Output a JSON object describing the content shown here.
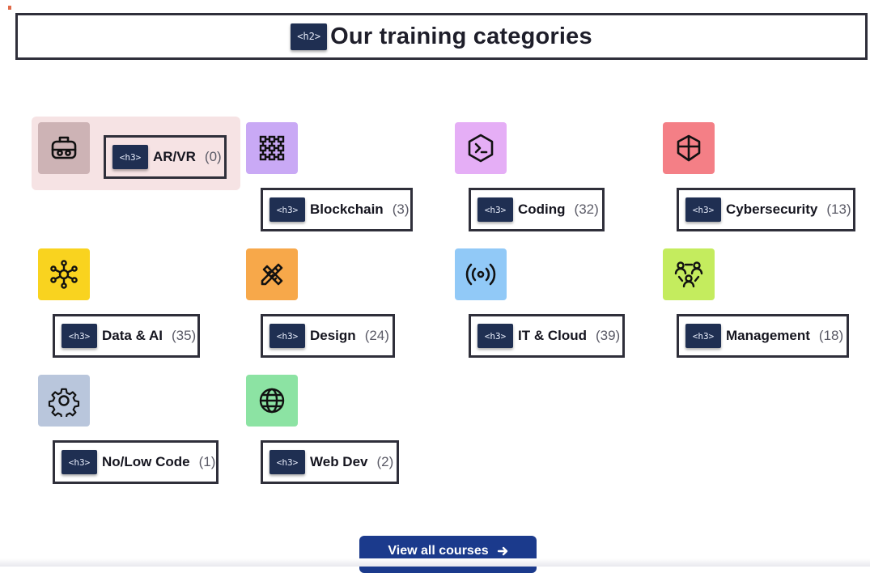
{
  "heading": {
    "tag": "<h2>",
    "title": "Our training categories"
  },
  "categories": [
    {
      "name": "AR/VR",
      "count": "(0)",
      "tag": "<h3>",
      "icon": "vr-headset-icon",
      "tile_color": "#cdb3b5"
    },
    {
      "name": "Blockchain",
      "count": "(3)",
      "tag": "<h3>",
      "icon": "blockchain-grid-icon",
      "tile_color": "#c9a9f5"
    },
    {
      "name": "Coding",
      "count": "(32)",
      "tag": "<h3>",
      "icon": "terminal-prompt-icon",
      "tile_color": "#e5aef6"
    },
    {
      "name": "Cybersecurity",
      "count": "(13)",
      "tag": "<h3>",
      "icon": "shield-icon",
      "tile_color": "#f47f86"
    },
    {
      "name": "Data & AI",
      "count": "(35)",
      "tag": "<h3>",
      "icon": "network-nodes-icon",
      "tile_color": "#f9d31f"
    },
    {
      "name": "Design",
      "count": "(24)",
      "tag": "<h3>",
      "icon": "pencil-ruler-icon",
      "tile_color": "#f7a84a"
    },
    {
      "name": "IT & Cloud",
      "count": "(39)",
      "tag": "<h3>",
      "icon": "broadcast-signal-icon",
      "tile_color": "#91c9f7"
    },
    {
      "name": "Management",
      "count": "(18)",
      "tag": "<h3>",
      "icon": "team-users-icon",
      "tile_color": "#c4ec5e"
    },
    {
      "name": "No/Low Code",
      "count": "(1)",
      "tag": "<h3>",
      "icon": "gear-icon",
      "tile_color": "#b9c6dc"
    },
    {
      "name": "Web Dev",
      "count": "(2)",
      "tag": "<h3>",
      "icon": "globe-icon",
      "tile_color": "#8ce3a3"
    }
  ],
  "cta": {
    "label": "View all courses",
    "icon": "arrow-right-icon",
    "color": "#1b3a8c"
  }
}
